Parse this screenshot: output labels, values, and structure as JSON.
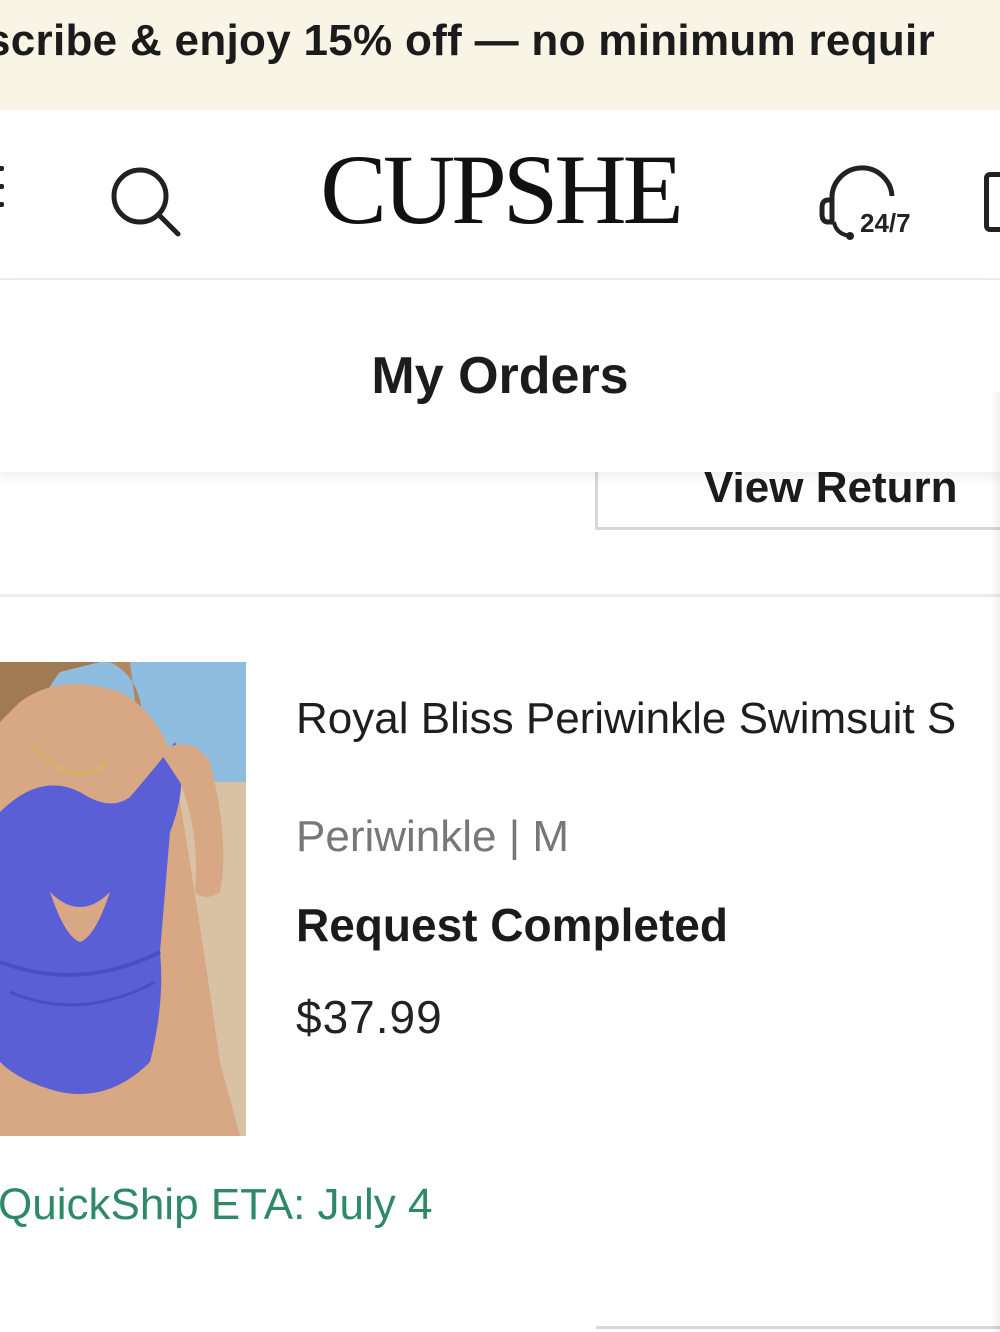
{
  "promo": {
    "text": "scribe & enjoy 15% off — no minimum requir"
  },
  "header": {
    "logo": "CUPSHE",
    "support_label": "24/7"
  },
  "page": {
    "title": "My Orders"
  },
  "order": {
    "view_return_label": "View Return",
    "item": {
      "name": "Royal Bliss Periwinkle Swimsuit S",
      "variant": "Periwinkle | M",
      "status": "Request Completed",
      "price": "$37.99",
      "eta": "QuickShip ETA: July 4"
    }
  },
  "colors": {
    "promo_bg": "#f8f5e6",
    "eta_green": "#2e8a66",
    "swimsuit_blue": "#5b5fd6"
  },
  "icons": [
    "menu-icon",
    "search-icon",
    "support-headset-icon",
    "shopping-bag-icon"
  ]
}
